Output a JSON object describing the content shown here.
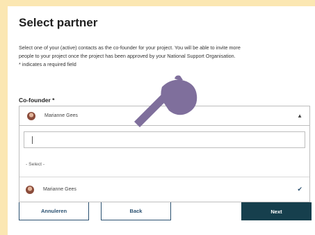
{
  "page": {
    "title": "Select partner",
    "description_line1": "Select one of your (active) contacts as the co-founder for your project. You will be able to invite more",
    "description_line2": "people to your project once the project has been approved by your National Support Organisation.",
    "required_note": "* indicates a required field"
  },
  "field": {
    "label": "Co-founder *",
    "selected_value": "Marianne Gees",
    "search_value": "",
    "placeholder_option": "- Select -",
    "options": [
      {
        "name": "Marianne Gees",
        "selected": true
      }
    ]
  },
  "buttons": {
    "cancel": "Annuleren",
    "back": "Back",
    "next": "Next"
  },
  "icons": {
    "open_indicator": "chevron-up-icon",
    "selected_indicator": "check-icon",
    "cursor": "pointing-hand-icon"
  },
  "colors": {
    "background": "#fbe7b2",
    "primary": "#163f4d",
    "outline": "#2a5070",
    "hand": "#7f6f9c"
  }
}
